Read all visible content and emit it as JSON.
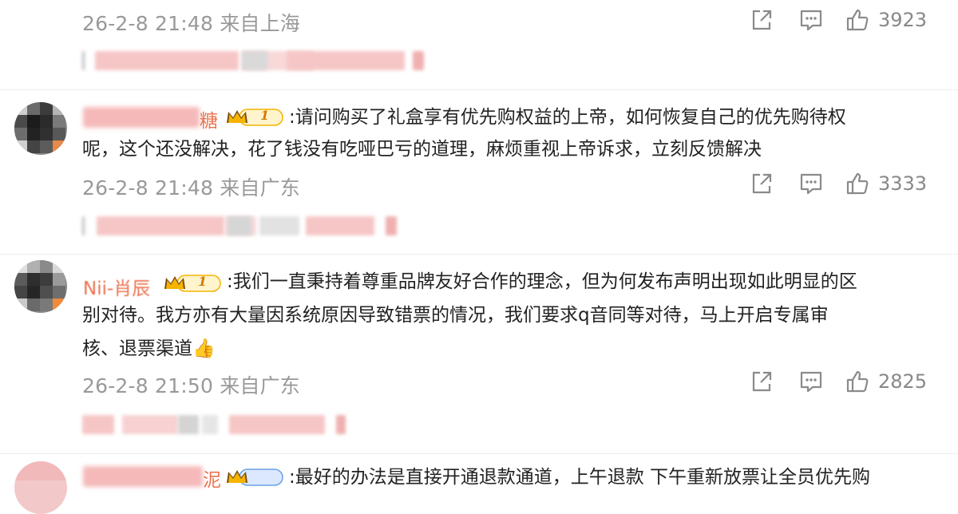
{
  "comments": [
    {
      "meta": "26-2-8 21:48 来自上海",
      "likes": "3923"
    },
    {
      "username_visible": "糖",
      "badge_level": "1",
      "lines": [
        ":请问购买了礼盒享有优先购权益的上帝，如何恢复自己的优先购待权",
        "呢，这个还没解决，花了钱没有吃哑巴亏的道理，麻烦重视上帝诉求，立刻反馈解决"
      ],
      "meta": "26-2-8 21:48 来自广东",
      "likes": "3333"
    },
    {
      "username_visible": "Nii-肖辰",
      "badge_level": "1",
      "lines": [
        ":我们一直秉持着尊重品牌友好合作的理念，但为何发布声明出现如此明显的区",
        "别对待。我方亦有大量因系统原因导致错票的情况，我们要求q音同等对待，马上开启专属审",
        "核、退票渠道👍"
      ],
      "meta": "26-2-8 21:50 来自广东",
      "likes": "2825"
    },
    {
      "username_visible": "泥",
      "lines": [
        ":最好的办法是直接开通退款通道，上午退款 下午重新放票让全员优先购"
      ]
    }
  ],
  "icons": {
    "share": "share-icon",
    "comment": "comment-icon",
    "like": "thumbs-up-icon"
  },
  "colors": {
    "meta": "#999999",
    "username": "#eb7350",
    "badge_gold": "#f4b400",
    "blur_pink": "#f5b4b4"
  }
}
